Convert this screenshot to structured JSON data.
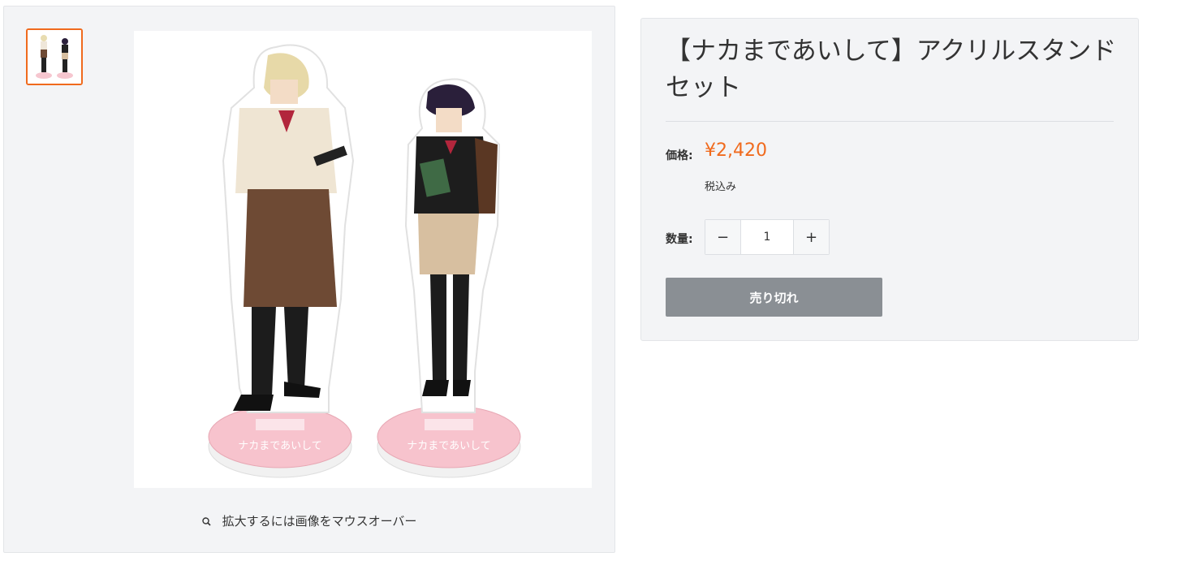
{
  "gallery": {
    "thumbnail_icon": "acrylic-stand-thumbnail",
    "main_image_icon": "acrylic-stand-product-photo",
    "base_text": "ナカまであいして",
    "zoom_icon": "search-icon",
    "zoom_hint": "拡大するには画像をマウスオーバー"
  },
  "product": {
    "title": "【ナカまであいして】アクリルスタンドセット",
    "price_label": "価格:",
    "price": "¥2,420",
    "tax_note": "税込み",
    "quantity_label": "数量:",
    "quantity_minus": "−",
    "quantity_value": "1",
    "quantity_plus": "+",
    "soldout_label": "売り切れ"
  },
  "colors": {
    "accent": "#f06a1d",
    "panel": "#f3f4f6",
    "button_disabled": "#8a8f94"
  }
}
